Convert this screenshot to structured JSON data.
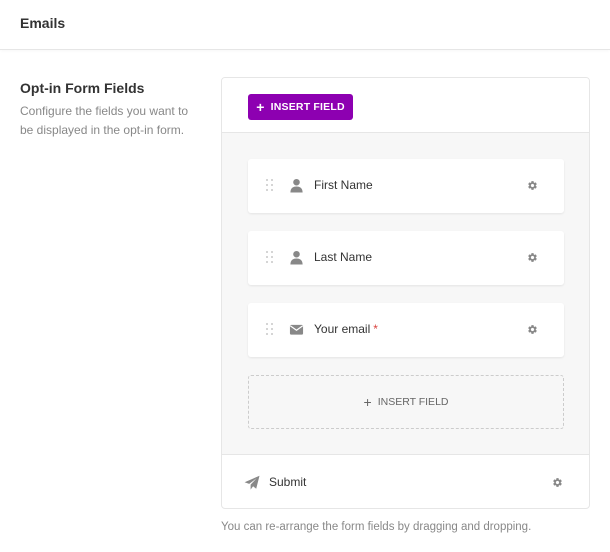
{
  "header": {
    "title": "Emails"
  },
  "section": {
    "title": "Opt-in Form Fields",
    "description": "Configure the fields you want to be displayed in the opt-in form."
  },
  "toolbar": {
    "insert_label": "INSERT FIELD",
    "plus": "+"
  },
  "fields": [
    {
      "label": "First Name",
      "icon": "user-icon",
      "required": false
    },
    {
      "label": "Last Name",
      "icon": "user-icon",
      "required": false
    },
    {
      "label": "Your email",
      "icon": "envelope-icon",
      "required": true,
      "required_mark": "*"
    }
  ],
  "dropzone": {
    "insert_label": "INSERT FIELD",
    "plus": "+"
  },
  "submit": {
    "label": "Submit",
    "icon": "paper-plane-icon"
  },
  "helper_text": "You can re-arrange the form fields by dragging and dropping.",
  "colors": {
    "accent": "#8d00b1",
    "required": "#d9433f",
    "icon": "#888888"
  }
}
